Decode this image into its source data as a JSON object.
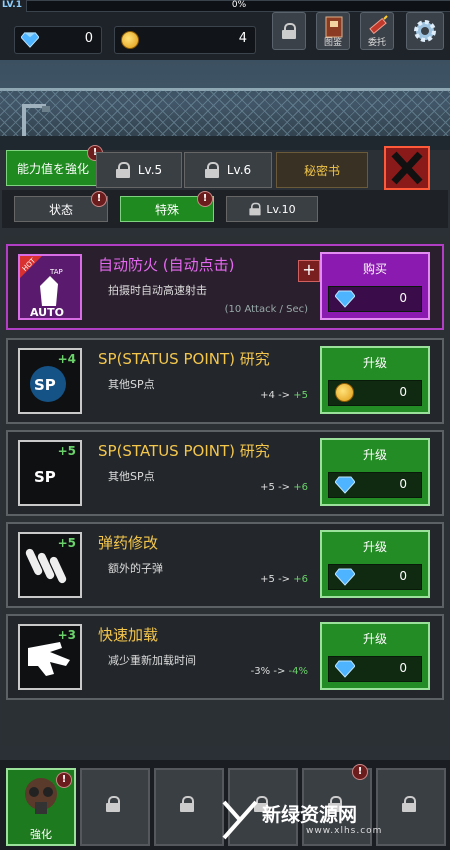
{
  "top": {
    "level_label": "LV.1",
    "xp_percent": "0%",
    "gems": "0",
    "coins": "4",
    "buttons": [
      {
        "name": "lock",
        "label": ""
      },
      {
        "name": "codex",
        "label": "图鉴"
      },
      {
        "name": "commission",
        "label": "委托"
      },
      {
        "name": "settings",
        "label": ""
      }
    ]
  },
  "tabs": {
    "main": [
      {
        "label": "能力值を強化",
        "state": "active"
      },
      {
        "label": "Lv.5",
        "state": "locked"
      },
      {
        "label": "Lv.6",
        "state": "locked"
      },
      {
        "label": "秘密书",
        "state": "secret"
      }
    ],
    "sub": [
      {
        "label": "状态",
        "state": "inactive"
      },
      {
        "label": "特殊",
        "state": "active"
      },
      {
        "label": "Lv.10",
        "state": "locked"
      }
    ]
  },
  "upgrades": [
    {
      "title": "自动防火 (自动点击)",
      "desc": "拍摄时自动高速射击",
      "rate": "(10 Attack / Sec)",
      "badge": "HOT",
      "badge2": "AUTO",
      "icon_text": "TAP",
      "button": "购买",
      "currency": "gem",
      "price": "0",
      "plus": "",
      "from": "",
      "to": "",
      "style": "hot"
    },
    {
      "title": "SP(STATUS POINT) 研究",
      "desc": "其他SP点",
      "plus": "+4",
      "from": "+4",
      "to": "+5",
      "icon_text": "SP",
      "button": "升级",
      "currency": "coin",
      "price": "0"
    },
    {
      "title": "SP(STATUS POINT) 研究",
      "desc": "其他SP点",
      "plus": "+5",
      "from": "+5",
      "to": "+6",
      "icon_text": "SP",
      "button": "升级",
      "currency": "gem",
      "price": "0"
    },
    {
      "title": "弹药修改",
      "desc": "额外的子弹",
      "plus": "+5",
      "from": "+5",
      "to": "+6",
      "icon_text": "",
      "button": "升级",
      "currency": "gem",
      "price": "0"
    },
    {
      "title": "快速加载",
      "desc": "减少重新加载时间",
      "plus": "+3",
      "from": "-3%",
      "to": "-4%",
      "icon_text": "",
      "button": "升级",
      "currency": "gem",
      "price": "0"
    }
  ],
  "bottom": {
    "first_label": "強化",
    "slots": 6
  },
  "watermark": {
    "text": "新绿资源网",
    "url": "www.xlhs.com"
  },
  "colors": {
    "accent_green": "#1f8a1f",
    "hot_purple": "#b23ec5",
    "title_gold": "#f3c64d",
    "gain_green": "#6bd26b"
  }
}
